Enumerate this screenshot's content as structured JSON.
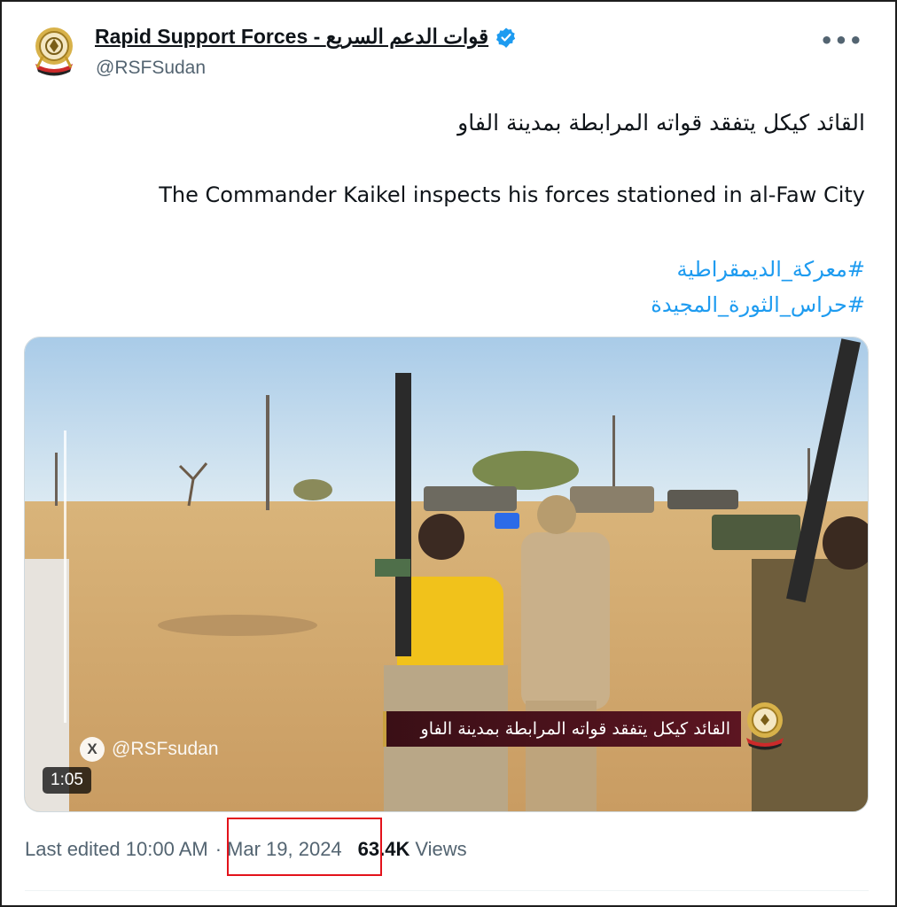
{
  "author": {
    "display_name": "Rapid Support Forces - قوات الدعم السريع",
    "handle": "@RSFSudan",
    "verified": true
  },
  "menu_icon": "more-horizontal-icon",
  "post": {
    "text_ar": "القائد كيكل يتفقد قواته المرابطة بمدينة الفاو",
    "text_en": "The Commander Kaikel inspects his forces stationed in al-Faw City",
    "hashtags": [
      "#معركة_الديمقراطية",
      "#حراس_الثورة_المجيدة"
    ]
  },
  "video": {
    "duration": "1:05",
    "watermark": "@RSFsudan",
    "caption": "القائد كيكل يتفقد قواته المرابطة بمدينة الفاو"
  },
  "meta": {
    "edited": "Last edited 10:00 AM",
    "separator": "·",
    "date": "Mar 19, 2024",
    "views_count": "63.4K",
    "views_label": "Views"
  },
  "colors": {
    "link": "#1d9bf0",
    "verified": "#1d9bf0",
    "highlight": "#e3121b",
    "secondary_text": "#536471"
  }
}
